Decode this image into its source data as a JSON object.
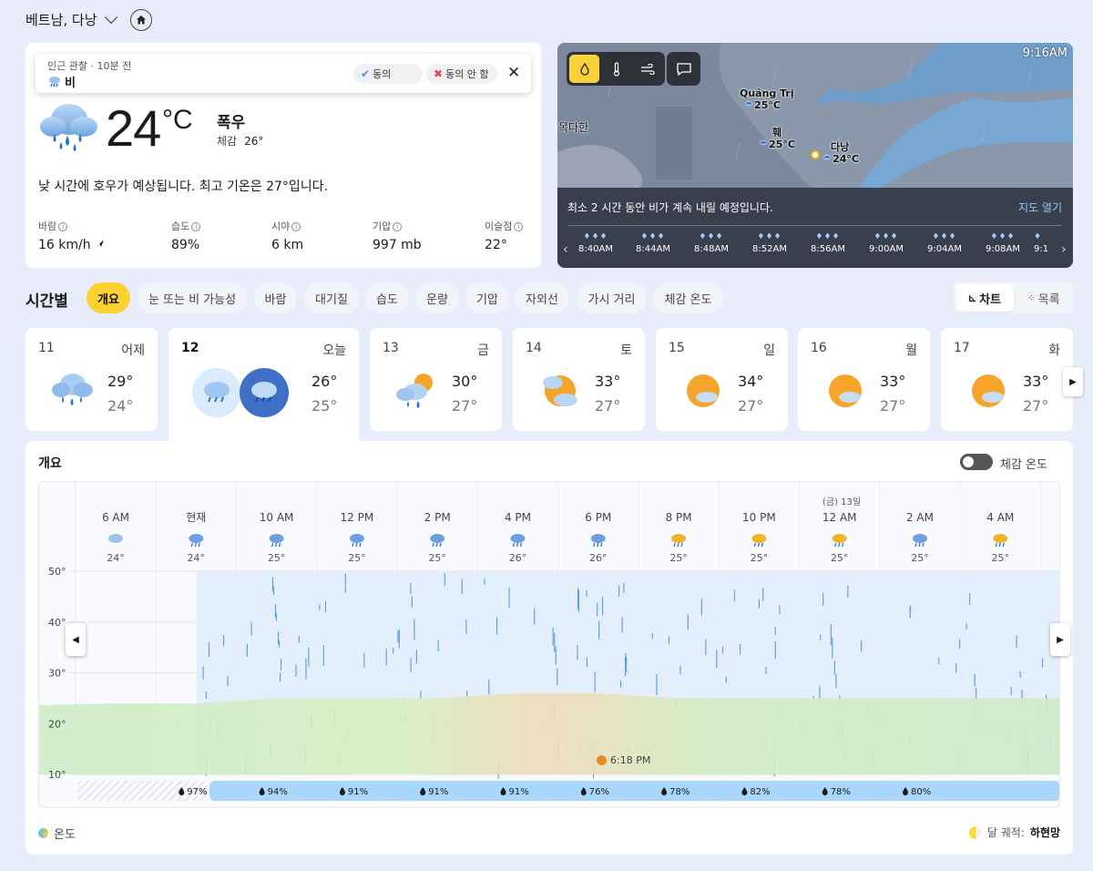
{
  "location": {
    "name": "베트남, 다낭"
  },
  "observation": {
    "header": "인근 관찰 · 10분 전",
    "condition": "비",
    "agree_label": "동의",
    "disagree_label": "동의 안 함"
  },
  "current": {
    "temp": "24",
    "unit": "°C",
    "condition": "폭우",
    "feels_label": "체감",
    "feels_value": "26°",
    "summary": "낮 시간에 호우가 예상됩니다. 최고 기온은 27°입니다.",
    "metrics": [
      {
        "label": "바람",
        "value": "16 km/h"
      },
      {
        "label": "습도",
        "value": "89%"
      },
      {
        "label": "시야",
        "value": "6 km"
      },
      {
        "label": "기압",
        "value": "997 mb"
      },
      {
        "label": "이슬점",
        "value": "22°"
      }
    ]
  },
  "map": {
    "time": "9:16AM",
    "message": "최소 2 시간 동안 비가 계속 내릴 예정입니다.",
    "open_label": "지도 열기",
    "cities": [
      {
        "name": "Quảng Trị",
        "temp": "25°C"
      },
      {
        "name": "훼",
        "temp": "25°C"
      },
      {
        "name": "다낭",
        "temp": "24°C"
      },
      {
        "name": "목다한",
        "temp": ""
      }
    ],
    "timeline": [
      "8:40AM",
      "8:44AM",
      "8:48AM",
      "8:52AM",
      "8:56AM",
      "9:00AM",
      "9:04AM",
      "9:08AM",
      "9:1"
    ]
  },
  "hourly": {
    "title": "시간별",
    "tabs": [
      "개요",
      "눈 또는 비 가능성",
      "바람",
      "대기질",
      "습도",
      "운량",
      "기압",
      "자외선",
      "가시 거리",
      "체감 온도"
    ],
    "view_chart": "차트",
    "view_list": "목록"
  },
  "days": [
    {
      "date": "11",
      "dow": "어제",
      "hi": "29°",
      "lo": "24°",
      "icon": "heavy-rain-icon"
    },
    {
      "date": "12",
      "dow": "오늘",
      "hi": "26°",
      "lo": "25°",
      "icon": "heavy-rain-icon"
    },
    {
      "date": "13",
      "dow": "금",
      "hi": "30°",
      "lo": "27°",
      "icon": "sun-rain-icon"
    },
    {
      "date": "14",
      "dow": "토",
      "hi": "33°",
      "lo": "27°",
      "icon": "partly-sunny-icon"
    },
    {
      "date": "15",
      "dow": "일",
      "hi": "34°",
      "lo": "27°",
      "icon": "partly-sunny-icon"
    },
    {
      "date": "16",
      "dow": "월",
      "hi": "33°",
      "lo": "27°",
      "icon": "partly-sunny-icon"
    },
    {
      "date": "17",
      "dow": "화",
      "hi": "33°",
      "lo": "27°",
      "icon": "partly-sunny-icon"
    }
  ],
  "overview": {
    "title": "개요",
    "toggle_label": "체감 온도",
    "legend_temp": "온도",
    "moon_label": "달 궤적:",
    "moon_value": "하현망",
    "sunset": "6:18 PM",
    "next_day_label": "(금) 13일"
  },
  "chart_data": {
    "type": "area",
    "x": [
      "6 AM",
      "현재",
      "10 AM",
      "12 PM",
      "2 PM",
      "4 PM",
      "6 PM",
      "8 PM",
      "10 PM",
      "12 AM",
      "2 AM",
      "4 AM"
    ],
    "hour_temps": [
      "24°",
      "24°",
      "25°",
      "25°",
      "25°",
      "26°",
      "26°",
      "25°",
      "25°",
      "25°",
      "25°",
      "25°"
    ],
    "temps": [
      24,
      24,
      25,
      25,
      25,
      26,
      26,
      25,
      25,
      25,
      25,
      25
    ],
    "precip": [
      "97%",
      "94%",
      "91%",
      "91%",
      "91%",
      "76%",
      "78%",
      "82%",
      "78%",
      "80%"
    ],
    "y_ticks": [
      "50°",
      "40°",
      "30°",
      "20°",
      "10°"
    ],
    "ylim": [
      10,
      50
    ]
  }
}
